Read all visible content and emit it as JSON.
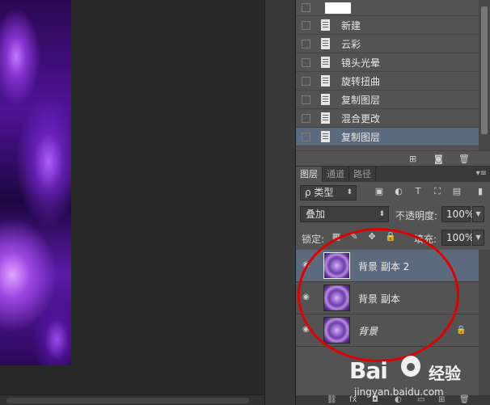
{
  "history": {
    "items": [
      {
        "label": "新建"
      },
      {
        "label": "云彩"
      },
      {
        "label": "镜头光晕"
      },
      {
        "label": "旋转扭曲"
      },
      {
        "label": "复制图层"
      },
      {
        "label": "混合更改"
      },
      {
        "label": "复制图层"
      }
    ],
    "selected_index": 6
  },
  "layers_panel": {
    "tabs": [
      "图层",
      "通道",
      "路径"
    ],
    "active_tab": "图层",
    "filter_label": "ρ 类型",
    "blend_mode": "叠加",
    "opacity_label": "不透明度:",
    "opacity_value": "100%",
    "lock_label": "锁定:",
    "fill_label": "填充:",
    "fill_value": "100%",
    "layers": [
      {
        "name": "背景 副本 2",
        "selected": true,
        "italic": false
      },
      {
        "name": "背景 副本",
        "selected": false,
        "italic": false
      },
      {
        "name": "背景",
        "selected": false,
        "italic": true,
        "locked": true
      }
    ]
  },
  "watermark": {
    "logo_text": "Bai",
    "chinese_text": "经验",
    "url": "jingyan.baidu.com"
  },
  "colors": {
    "panel_bg": "#535353",
    "selected_row": "#5b6a7c",
    "annotation": "#e00000"
  }
}
